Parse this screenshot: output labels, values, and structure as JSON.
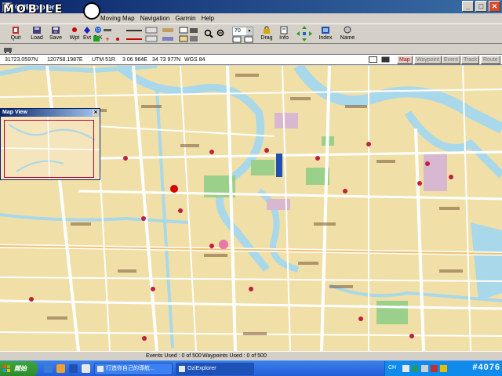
{
  "window": {
    "title": "OziExplorer -"
  },
  "watermark": "MOBILE",
  "menu": [
    "Moving Map",
    "Navigation",
    "Garmin",
    "Help"
  ],
  "toolbar": {
    "quit": "Quit",
    "load": "Load",
    "save": "Save",
    "wpt": "Wpt",
    "evt": "Evt",
    "trk": "TrK",
    "zoom_value": "70",
    "drag": "Drag",
    "info": "Info",
    "index": "Index",
    "name": "Name"
  },
  "status": {
    "lat": "31723.0597N",
    "lon": "120758.1987E",
    "utm": "UTM  51R",
    "easting": "3 06 964E",
    "northing": "34 73 977N",
    "datum": "WGS 84",
    "tabs": [
      "Map",
      "Waypoint",
      "Event",
      "Track",
      "Route"
    ]
  },
  "map_view": {
    "title": "Map View"
  },
  "bottom": {
    "events": "Events Used : 0 of 500",
    "waypoints": "Waypoints Used : 0 of 500"
  },
  "taskbar": {
    "start": "開始",
    "items": [
      "打造你自己的導航...",
      "OziExplorer"
    ],
    "tray": "CH",
    "clock": "#4076"
  }
}
